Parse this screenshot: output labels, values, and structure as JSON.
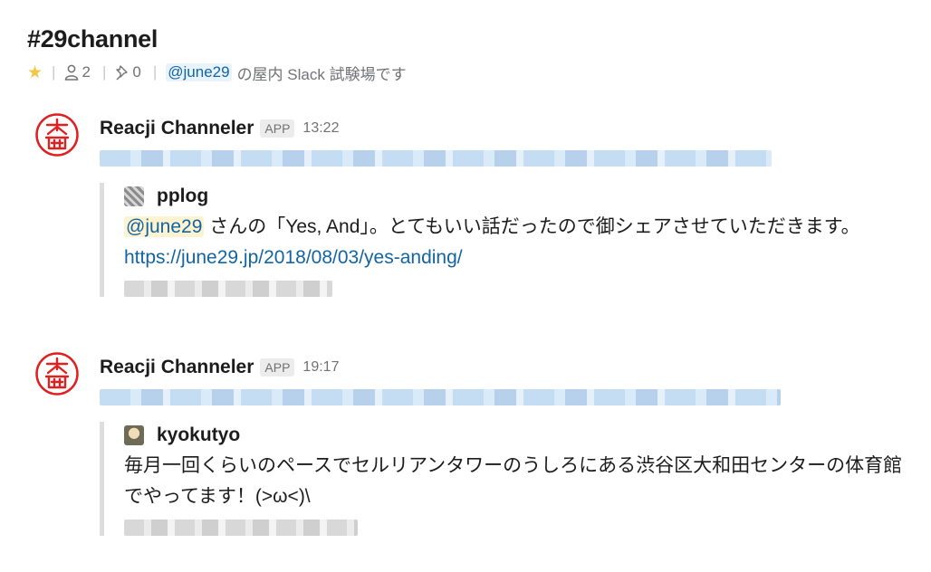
{
  "channel": {
    "title": "#29channel",
    "member_count": "2",
    "pin_count": "0",
    "topic_mention": "@june29",
    "topic_text": "の屋内 Slack 試験場です"
  },
  "messages": [
    {
      "sender": "Reacji Channeler",
      "badge": "APP",
      "time": "13:22",
      "attachment": {
        "author": "pplog",
        "mention": "@june29",
        "text": "さんの「Yes, And」。とてもいい話だったので御シェアさせていただきます。",
        "link": "https://june29.jp/2018/08/03/yes-anding/"
      }
    },
    {
      "sender": "Reacji Channeler",
      "badge": "APP",
      "time": "19:17",
      "attachment": {
        "author": "kyokutyo",
        "text": "毎月一回くらいのペースでセルリアンタワーのうしろにある渋谷区大和田センターの体育館でやってます！(>ω<)\\"
      }
    }
  ],
  "colors": {
    "link": "#1264a3",
    "star": "#f2c744",
    "avatar_seal": "#e02020"
  },
  "icons": {
    "star": "star-icon",
    "members": "person-icon",
    "pins": "pin-icon",
    "avatar": "seal-avatar"
  }
}
